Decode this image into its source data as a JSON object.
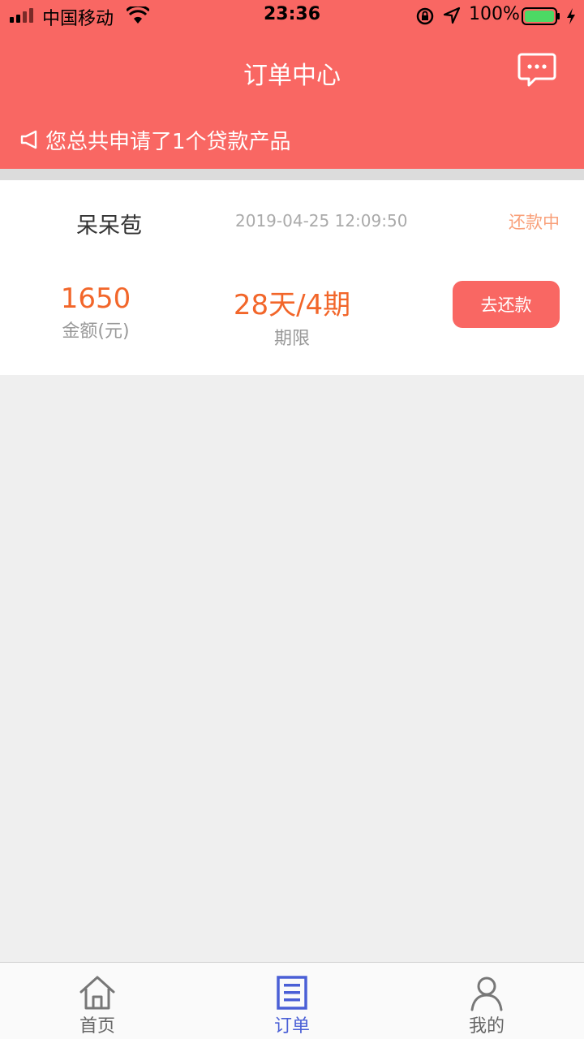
{
  "status_bar": {
    "carrier": "中国移动",
    "time": "23:36",
    "battery": "100%"
  },
  "header": {
    "title": "订单中心",
    "notice": "您总共申请了1个贷款产品",
    "message_icon": "chat-bubble-icon"
  },
  "order": {
    "product_name": "呆呆苞",
    "date": "2019-04-25 12:09:50",
    "status": "还款中",
    "amount_value": "1650",
    "amount_label": "金额(元)",
    "term_value": "28天/4期",
    "term_label": "期限",
    "repay_button": "去还款"
  },
  "tabbar": {
    "items": [
      {
        "label": "首页",
        "icon": "home-icon"
      },
      {
        "label": "订单",
        "icon": "order-list-icon",
        "active": true
      },
      {
        "label": "我的",
        "icon": "person-icon"
      }
    ]
  },
  "colors": {
    "brand": "#f96763",
    "accent_orange": "#f2662a",
    "tab_active": "#4a5fd6"
  }
}
